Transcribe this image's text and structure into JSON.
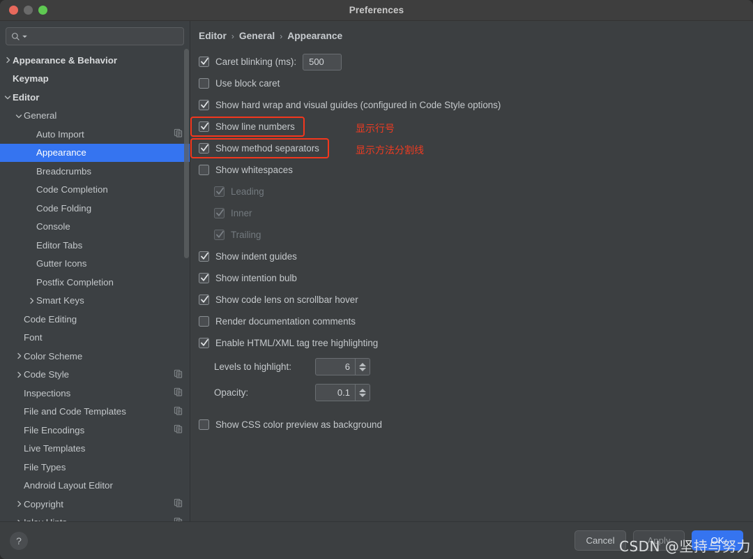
{
  "window": {
    "title": "Preferences",
    "traffic_lights": [
      "close-button",
      "minimize-button",
      "maximize-button"
    ],
    "accent_blue": "#3574f0",
    "annotation_red": "#f4371d",
    "bg_main": "#3c3f41",
    "bg_sidebar": "#3c4043",
    "bg_titlebar": "#3e3e3e"
  },
  "search": {
    "value": "",
    "placeholder": "",
    "icon": "search-icon"
  },
  "sidebar": {
    "items": [
      {
        "label": "Appearance & Behavior",
        "depth": 0,
        "arrow": "chevron-right",
        "bold": true,
        "selected": false,
        "copy_icon": false
      },
      {
        "label": "Keymap",
        "depth": 0,
        "arrow": "none",
        "bold": true,
        "selected": false,
        "copy_icon": false
      },
      {
        "label": "Editor",
        "depth": 0,
        "arrow": "chevron-down",
        "bold": true,
        "selected": false,
        "copy_icon": false
      },
      {
        "label": "General",
        "depth": 1,
        "arrow": "chevron-down",
        "bold": false,
        "selected": false,
        "copy_icon": false
      },
      {
        "label": "Auto Import",
        "depth": 2,
        "arrow": "none",
        "bold": false,
        "selected": false,
        "copy_icon": true
      },
      {
        "label": "Appearance",
        "depth": 2,
        "arrow": "none",
        "bold": false,
        "selected": true,
        "copy_icon": false
      },
      {
        "label": "Breadcrumbs",
        "depth": 2,
        "arrow": "none",
        "bold": false,
        "selected": false,
        "copy_icon": false
      },
      {
        "label": "Code Completion",
        "depth": 2,
        "arrow": "none",
        "bold": false,
        "selected": false,
        "copy_icon": false
      },
      {
        "label": "Code Folding",
        "depth": 2,
        "arrow": "none",
        "bold": false,
        "selected": false,
        "copy_icon": false
      },
      {
        "label": "Console",
        "depth": 2,
        "arrow": "none",
        "bold": false,
        "selected": false,
        "copy_icon": false
      },
      {
        "label": "Editor Tabs",
        "depth": 2,
        "arrow": "none",
        "bold": false,
        "selected": false,
        "copy_icon": false
      },
      {
        "label": "Gutter Icons",
        "depth": 2,
        "arrow": "none",
        "bold": false,
        "selected": false,
        "copy_icon": false
      },
      {
        "label": "Postfix Completion",
        "depth": 2,
        "arrow": "none",
        "bold": false,
        "selected": false,
        "copy_icon": false
      },
      {
        "label": "Smart Keys",
        "depth": 2,
        "arrow": "chevron-right",
        "bold": false,
        "selected": false,
        "copy_icon": false
      },
      {
        "label": "Code Editing",
        "depth": 1,
        "arrow": "none",
        "bold": false,
        "selected": false,
        "copy_icon": false
      },
      {
        "label": "Font",
        "depth": 1,
        "arrow": "none",
        "bold": false,
        "selected": false,
        "copy_icon": false
      },
      {
        "label": "Color Scheme",
        "depth": 1,
        "arrow": "chevron-right",
        "bold": false,
        "selected": false,
        "copy_icon": false
      },
      {
        "label": "Code Style",
        "depth": 1,
        "arrow": "chevron-right",
        "bold": false,
        "selected": false,
        "copy_icon": true
      },
      {
        "label": "Inspections",
        "depth": 1,
        "arrow": "none",
        "bold": false,
        "selected": false,
        "copy_icon": true
      },
      {
        "label": "File and Code Templates",
        "depth": 1,
        "arrow": "none",
        "bold": false,
        "selected": false,
        "copy_icon": true
      },
      {
        "label": "File Encodings",
        "depth": 1,
        "arrow": "none",
        "bold": false,
        "selected": false,
        "copy_icon": true
      },
      {
        "label": "Live Templates",
        "depth": 1,
        "arrow": "none",
        "bold": false,
        "selected": false,
        "copy_icon": false
      },
      {
        "label": "File Types",
        "depth": 1,
        "arrow": "none",
        "bold": false,
        "selected": false,
        "copy_icon": false
      },
      {
        "label": "Android Layout Editor",
        "depth": 1,
        "arrow": "none",
        "bold": false,
        "selected": false,
        "copy_icon": false
      },
      {
        "label": "Copyright",
        "depth": 1,
        "arrow": "chevron-right",
        "bold": false,
        "selected": false,
        "copy_icon": true
      },
      {
        "label": "Inlay Hints",
        "depth": 1,
        "arrow": "chevron-right",
        "bold": false,
        "selected": false,
        "copy_icon": true
      }
    ]
  },
  "breadcrumb": {
    "parts": [
      "Editor",
      "General",
      "Appearance"
    ],
    "separator": "›"
  },
  "options": [
    {
      "id": "caret-blinking",
      "label": "Caret blinking (ms):",
      "checked": true,
      "enabled": true,
      "indent": 0,
      "field": "500"
    },
    {
      "id": "use-block-caret",
      "label": "Use block caret",
      "checked": false,
      "enabled": true,
      "indent": 0
    },
    {
      "id": "show-hard-wrap",
      "label": "Show hard wrap and visual guides (configured in Code Style options)",
      "checked": true,
      "enabled": true,
      "indent": 0
    },
    {
      "id": "show-line-numbers",
      "label": "Show line numbers",
      "checked": true,
      "enabled": true,
      "indent": 0,
      "highlighted": true
    },
    {
      "id": "show-method-separators",
      "label": "Show method separators",
      "checked": true,
      "enabled": true,
      "indent": 0,
      "highlighted": true
    },
    {
      "id": "show-whitespaces",
      "label": "Show whitespaces",
      "checked": false,
      "enabled": true,
      "indent": 0
    },
    {
      "id": "leading",
      "label": "Leading",
      "checked": true,
      "enabled": false,
      "indent": 1
    },
    {
      "id": "inner",
      "label": "Inner",
      "checked": true,
      "enabled": false,
      "indent": 1
    },
    {
      "id": "trailing",
      "label": "Trailing",
      "checked": true,
      "enabled": false,
      "indent": 1
    },
    {
      "id": "show-indent-guides",
      "label": "Show indent guides",
      "checked": true,
      "enabled": true,
      "indent": 0
    },
    {
      "id": "show-intention-bulb",
      "label": "Show intention bulb",
      "checked": true,
      "enabled": true,
      "indent": 0
    },
    {
      "id": "show-code-lens",
      "label": "Show code lens on scrollbar hover",
      "checked": true,
      "enabled": true,
      "indent": 0
    },
    {
      "id": "render-doc-comments",
      "label": "Render documentation comments",
      "checked": false,
      "enabled": true,
      "indent": 0
    },
    {
      "id": "enable-tag-tree",
      "label": "Enable HTML/XML tag tree highlighting",
      "checked": true,
      "enabled": true,
      "indent": 0
    }
  ],
  "spinners": [
    {
      "id": "levels-to-highlight",
      "label": "Levels to highlight:",
      "value": "6"
    },
    {
      "id": "opacity",
      "label": "Opacity:",
      "value": "0.1"
    }
  ],
  "trailing_option": {
    "id": "show-css-color-preview",
    "label": "Show CSS color preview as background",
    "checked": false
  },
  "annotations": [
    {
      "text": "显示行号",
      "target": "show-line-numbers"
    },
    {
      "text": "显示方法分割线",
      "target": "show-method-separators"
    }
  ],
  "footer": {
    "help_label": "?",
    "cancel_label": "Cancel",
    "apply_label": "Apply",
    "ok_label": "OK"
  },
  "watermark": {
    "text": "CSDN @坚持与努力"
  }
}
